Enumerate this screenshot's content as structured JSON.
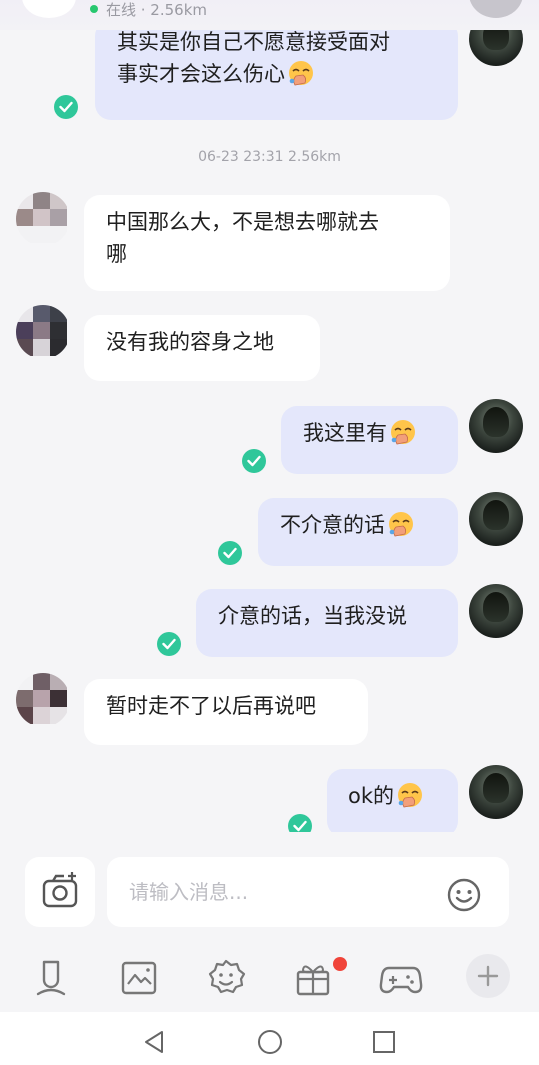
{
  "header": {
    "status_text": "在线 · 2.56km"
  },
  "messages": [
    {
      "dir": "out",
      "text": "其实是你自己不愿意接受面对事实才会这么伤心",
      "line2": "",
      "emoji": "face-with-hand-over-mouth-emoji"
    },
    {
      "timestamp": "06-23 23:31",
      "distance": "2.56km"
    },
    {
      "dir": "in",
      "text": "中国那么大，不是想去哪就去哪"
    },
    {
      "dir": "in",
      "text": "没有我的容身之地"
    },
    {
      "dir": "out",
      "text": "我这里有",
      "emoji": "face-with-hand-over-mouth-emoji"
    },
    {
      "dir": "out",
      "text": "不介意的话",
      "emoji": "face-with-hand-over-mouth-emoji"
    },
    {
      "dir": "out",
      "text": "介意的话，当我没说"
    },
    {
      "dir": "in",
      "text": "暂时走不了以后再说吧"
    },
    {
      "dir": "out",
      "text": "ok的",
      "emoji": "face-with-hand-over-mouth-emoji"
    }
  ],
  "msg": {
    "m0a": "其实是你自己不愿意接受面对",
    "m0b": "事实才会这么伤心",
    "m2a": "中国那么大，不是想去哪就去",
    "m2b": "哪"
  },
  "timestamp_line": "06-23 23:31  2.56km",
  "input": {
    "placeholder": "请输入消息..."
  },
  "toolbar": {
    "icons": [
      "microphone-icon",
      "image-icon",
      "emoji-icon",
      "gift-icon",
      "game-controller-icon",
      "plus-icon"
    ]
  },
  "navbar": {
    "icons": [
      "back-triangle-icon",
      "home-circle-icon",
      "recents-square-icon"
    ]
  },
  "colors": {
    "accent_check": "#2fc79a",
    "out_bubble": "#e4e7fb",
    "in_bubble": "#ffffff",
    "badge": "#f0443a",
    "online_dot": "#28c76f"
  }
}
